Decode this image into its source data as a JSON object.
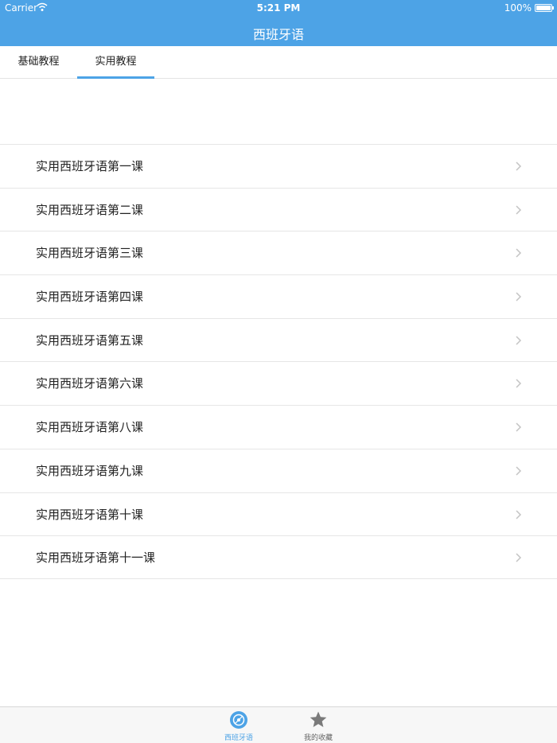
{
  "status_bar": {
    "carrier": "Carrier",
    "time": "5:21 PM",
    "battery": "100%"
  },
  "nav": {
    "title": "西班牙语"
  },
  "tabs": [
    {
      "label": "基础教程",
      "active": false
    },
    {
      "label": "实用教程",
      "active": true
    }
  ],
  "lessons": [
    {
      "label": "实用西班牙语第一课"
    },
    {
      "label": "实用西班牙语第二课"
    },
    {
      "label": "实用西班牙语第三课"
    },
    {
      "label": "实用西班牙语第四课"
    },
    {
      "label": "实用西班牙语第五课"
    },
    {
      "label": "实用西班牙语第六课"
    },
    {
      "label": "实用西班牙语第八课"
    },
    {
      "label": "实用西班牙语第九课"
    },
    {
      "label": "实用西班牙语第十课"
    },
    {
      "label": "实用西班牙语第十一课"
    }
  ],
  "tabbar": [
    {
      "label": "西班牙语",
      "icon": "disc-icon",
      "active": true
    },
    {
      "label": "我的收藏",
      "icon": "star-icon",
      "active": false
    }
  ],
  "colors": {
    "accent": "#4da3e6",
    "inactive": "#666666"
  }
}
